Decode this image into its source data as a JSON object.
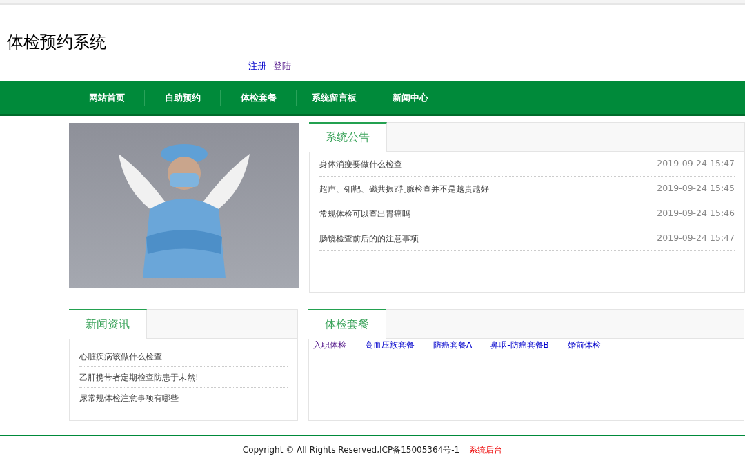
{
  "header": {
    "title": "体检预约系统",
    "links": [
      {
        "label": "注册",
        "visited": false
      },
      {
        "label": "登陆",
        "visited": true
      }
    ]
  },
  "nav": [
    "网站首页",
    "自助预约",
    "体检套餐",
    "系统留言板",
    "新闻中心"
  ],
  "notices": {
    "title": "系统公告",
    "items": [
      {
        "title": "身体消瘦要做什么检查",
        "time": "2019-09-24 15:47"
      },
      {
        "title": "超声、钼靶、磁共振?乳腺检查并不是越贵越好",
        "time": "2019-09-24 15:45"
      },
      {
        "title": "常规体检可以查出胃癌吗",
        "time": "2019-09-24 15:46"
      },
      {
        "title": "肠镜检查前后的的注意事项",
        "time": "2019-09-24 15:47"
      }
    ]
  },
  "news": {
    "title": "新闻资讯",
    "items": [
      "心脏疾病该做什么检查",
      "乙肝携带者定期检查防患于未然!",
      "尿常规体检注意事项有哪些"
    ]
  },
  "packages": {
    "title": "体检套餐",
    "items": [
      {
        "label": "入职体检",
        "visited": true
      },
      {
        "label": "高血压族套餐",
        "visited": false
      },
      {
        "label": "防癌套餐A",
        "visited": false
      },
      {
        "label": "鼻咽-防癌套餐B",
        "visited": false
      },
      {
        "label": "婚前体检",
        "visited": false
      }
    ]
  },
  "footer": {
    "copyright": "Copyright © All Rights Reserved,ICP备15005364号-1",
    "admin_link": "系统后台"
  }
}
